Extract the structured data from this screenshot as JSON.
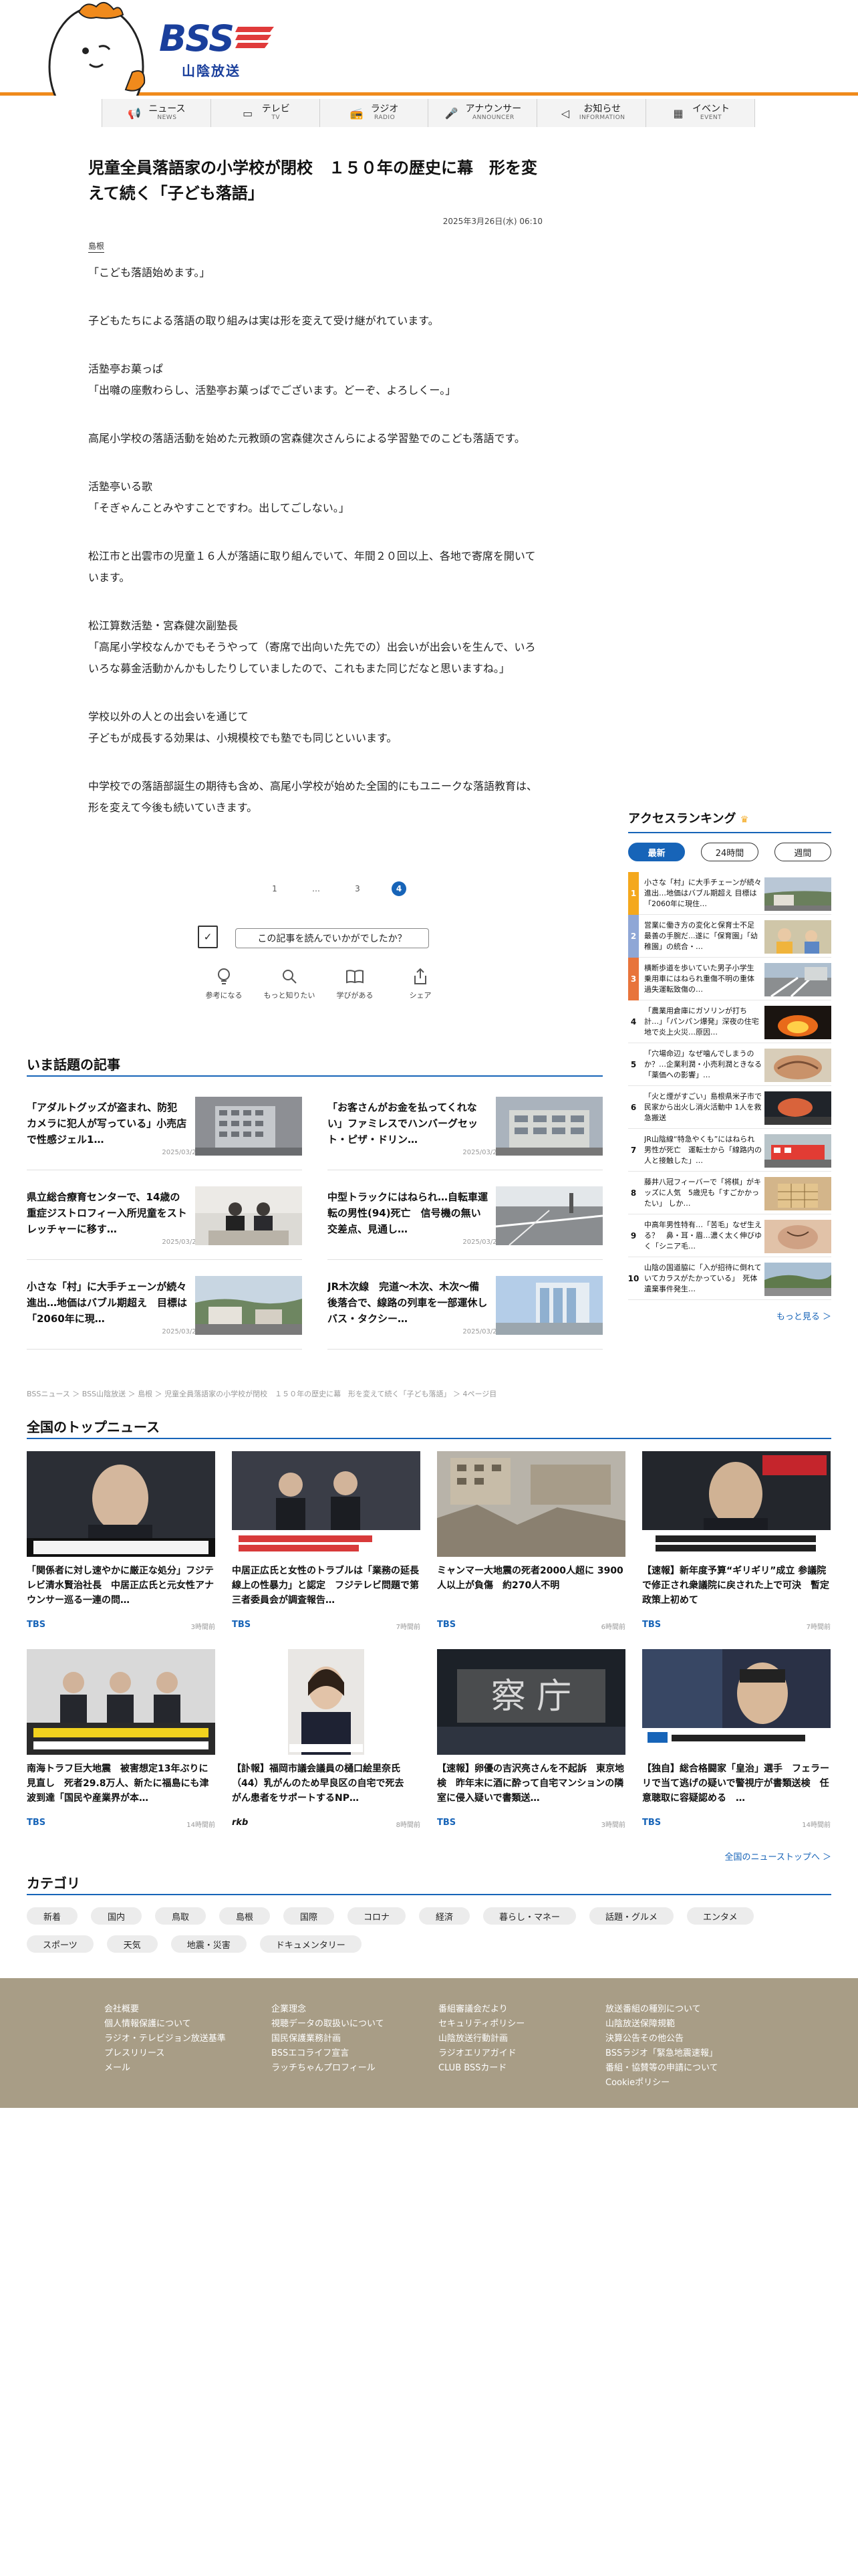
{
  "header": {
    "logo_text": "BSS",
    "logo_sub": "山陰放送"
  },
  "nav": [
    {
      "ja": "ニュース",
      "en": "NEWS",
      "icon": "megaphone-icon"
    },
    {
      "ja": "テレビ",
      "en": "TV",
      "icon": "tv-icon"
    },
    {
      "ja": "ラジオ",
      "en": "RADIO",
      "icon": "radio-icon"
    },
    {
      "ja": "アナウンサー",
      "en": "ANNOUNCER",
      "icon": "microphone-icon"
    },
    {
      "ja": "お知らせ",
      "en": "INFORMATION",
      "icon": "speaker-icon"
    },
    {
      "ja": "イベント",
      "en": "EVENT",
      "icon": "calendar-icon"
    }
  ],
  "article": {
    "title": "児童全員落語家の小学校が閉校　１５０年の歴史に幕　形を変えて続く「子ども落語」",
    "date": "2025年3月26日(水) 06:10",
    "tag": "島根",
    "paragraphs": [
      "「こども落語始めます。」",
      "子どもたちによる落語の取り組みは実は形を変えて受け継がれています。",
      "活塾亭お菓っぱ\n「出囃の座敷わらし、活塾亭お菓っぱでございます。どーぞ、よろしくー。」",
      "高尾小学校の落語活動を始めた元教頭の宮森健次さんらによる学習塾でのこども落語です。",
      "活塾亭いる歌\n「そぎゃんことみやすことですわ。出してごしない。」",
      "松江市と出雲市の児童１６人が落語に取り組んでいて、年間２０回以上、各地で寄席を開いています。",
      "松江算数活塾・宮森健次副塾長\n「高尾小学校なんかでもそうやって（寄席で出向いた先での）出会いが出会いを生んで、いろいろな募金活動かんかもしたりしていましたので、これもまた同じだなと思いますね。」",
      "学校以外の人との出会いを通じて\n子どもが成長する効果は、小規模校でも塾でも同じといいます。",
      "中学校での落語部誕生の期待も含め、高尾小学校が始めた全国的にもユニークな落語教育は、形を変えて今後も続いていきます。"
    ]
  },
  "pager": [
    "1",
    "…",
    "3",
    "4"
  ],
  "feedback": {
    "question": "この記事を読んでいかがでしたか？",
    "reactions": [
      {
        "label": "参考になる",
        "icon": "lightbulb-icon"
      },
      {
        "label": "もっと知りたい",
        "icon": "magnifier-icon"
      },
      {
        "label": "学びがある",
        "icon": "book-icon"
      },
      {
        "label": "シェア",
        "icon": "share-icon"
      }
    ]
  },
  "trending": {
    "heading": "いま話題の記事",
    "items": [
      {
        "title": "「アダルトグッズが盗まれ、防犯カメラに犯人が写っている」小売店で性感ジェル1…",
        "date": "2025/03/25"
      },
      {
        "title": "「お客さんがお金を払ってくれない」ファミレスでハンバーグセット・ピザ・ドリン…",
        "date": "2025/03/24"
      },
      {
        "title": "県立総合療育センターで、14歳の重症ジストロフィー入所児童をストレッチャーに移す…",
        "date": "2025/03/26"
      },
      {
        "title": "中型トラックにはねられ…自転車運転の男性(94)死亡　信号機の無い交差点、見通し…",
        "date": "2025/03/25"
      },
      {
        "title": "小さな「村」に大手チェーンが続々進出…地価はバブル期超え　目標は「2060年に現…",
        "date": "2025/03/26"
      },
      {
        "title": "JR木次線　完道～木次、木次～備後落合で、線路の列車を一部運休しバス・タクシー…",
        "date": "2025/03/26"
      }
    ]
  },
  "ranking": {
    "heading": "アクセスランキング",
    "tabs": [
      "最新",
      "24時間",
      "週間"
    ],
    "items": [
      "小さな「村」に大手チェーンが続々進出…地価はバブル期超え 目標は「2060年に現住…",
      "営業に働き方の変化と保育士不足　最善の手腕だ...遂に「保育園」「幼稚園」の統合・…",
      "横断歩道を歩いていた男子小学生 乗用車にはねられ重傷不明の重体　過失運転致傷の…",
      "「農業用倉庫にガソリンが打ち計…」「パンパン爆発」深夜の住宅地で炎上火災…原因…",
      "「穴場命辺」なぜ噛んでしまうのか？…企業利潤・小売利潤ときなる「薬価への影響」…",
      "「火と煙がすごい」島根県米子市で民家から出火し消火活動中 1人を救急搬送",
      "JR山陰線“特急やくも”にはねられ男性が死亡　運転士から「線路内の人と接触した」…",
      "藤井八冠フィーバーで「将棋」がキッズに人気　5歳児も「すごかかったい」 しか…",
      "中高年男性特有…「苦毛」なぜ生える？　鼻・耳・眉…濃く太く伸びゆく「シニア毛…",
      "山陰の国道脇に「入が招待に倒れていてカラスがたかっている」　死体遺棄事件発生…"
    ],
    "more": "もっと見る ＞"
  },
  "breadcrumb": "BSSニュース ＞ BSS山陰放送 ＞ 島根 ＞ 児童全員落語家の小学校が閉校　１５０年の歴史に幕　形を変えて続く「子ども落語」 ＞ 4ページ目",
  "national": {
    "heading": "全国のトップニュース",
    "items": [
      {
        "title": "「関係者に対し速やかに厳正な処分」フジテレビ清水賢治社長　中居正広氏と元女性アナウンサー巡る一連の問…",
        "source": "TBS",
        "time": "3時間前"
      },
      {
        "title": "中居正広氏と女性のトラブルは「業務の延長線上の性暴力」と認定　フジテレビ問題で第三者委員会が調査報告…",
        "source": "TBS",
        "time": "7時間前"
      },
      {
        "title": "ミャンマー大地震の死者2000人超に 3900人以上が負傷　約270人不明",
        "source": "TBS",
        "time": "6時間前"
      },
      {
        "title": "【速報】新年度予算“ギリギリ”成立 参議院で修正され衆議院に戻された上で可決　暫定政策上初めて",
        "source": "TBS",
        "time": "7時間前"
      },
      {
        "title": "南海トラフ巨大地震　被害想定13年ぶりに見直し　死者29.8万人、新たに福島にも津波到達「国民や産業界が本…",
        "source": "TBS",
        "time": "14時間前"
      },
      {
        "title": "【訃報】福岡市議会議員の樋口絵里奈氏（44）乳がんのため早良区の自宅で死去　がん患者をサポートするNP…",
        "source": "rkb",
        "time": "8時間前"
      },
      {
        "title": "【速報】卵優の吉沢亮さんを不起訴　東京地検　昨年末に酒に酔って自宅マンションの隣室に侵入疑いで書類送…",
        "source": "TBS",
        "time": "3時間前"
      },
      {
        "title": "【独自】総合格闘家「皇治」選手　フェラーリで当て逃げの疑いで警視庁が書類送検　任意聴取に容疑認める　…",
        "source": "TBS",
        "time": "14時間前"
      }
    ],
    "more": "全国のニューストップへ ＞"
  },
  "category": {
    "heading": "カテゴリ",
    "items": [
      "新着",
      "国内",
      "鳥取",
      "島根",
      "国際",
      "コロナ",
      "経済",
      "暮らし・マネー",
      "話題・グルメ",
      "エンタメ",
      "スポーツ",
      "天気",
      "地震・災害",
      "ドキュメンタリー"
    ]
  },
  "footer": {
    "col1": [
      "会社概要",
      "個人情報保護について",
      "ラジオ・テレビジョン放送基準",
      "プレスリリース",
      "メール"
    ],
    "col2": [
      "企業理念",
      "視聴データの取扱いについて",
      "国民保護業務計画",
      "BSSエコライフ宣言",
      "ラッチちゃんプロフィール"
    ],
    "col3": [
      "番組審議会だより",
      "セキュリティポリシー",
      "山陰放送行動計画",
      "ラジオエリアガイド",
      "CLUB BSSカード"
    ],
    "col4": [
      "放送番組の種別について",
      "山陰放送保障規範",
      "決算公告その他公告",
      "BSSラジオ「緊急地震速報」",
      "番組・協賛等の申請について",
      "Cookieポリシー"
    ]
  },
  "colors": {
    "accent": "#1764b8",
    "orange": "#f08a1c",
    "footer": "#a89d86"
  }
}
